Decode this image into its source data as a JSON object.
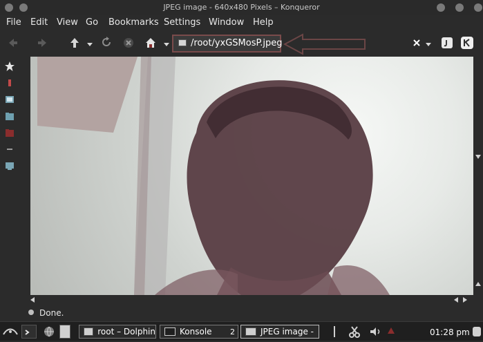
{
  "window": {
    "title": "JPEG image - 640x480 Pixels – Konqueror"
  },
  "menubar": {
    "items": [
      "File",
      "Edit",
      "View",
      "Go",
      "Bookmarks",
      "Settings",
      "Window",
      "Help"
    ]
  },
  "toolbar": {
    "address": "/root/yxGSMosP.jpeg"
  },
  "status": {
    "text": "Done."
  },
  "taskbar": {
    "tasks": [
      {
        "label": "root – Dolphin"
      },
      {
        "label": "Konsole",
        "badge": "2"
      },
      {
        "label": "JPEG image - "
      }
    ],
    "clock": "01:28 pm"
  },
  "colors": {
    "window_bg": "#2b2b2b",
    "address_highlight": "#7a4b4b",
    "annotation_arrow": "#6b4646"
  },
  "icons": {
    "toolbar": [
      "back-arrow-icon",
      "forward-arrow-icon",
      "up-arrow-icon",
      "reload-icon",
      "stop-icon",
      "home-icon",
      "clear-icon",
      "java-icon",
      "konqueror-icon"
    ],
    "sidebar": [
      "star-icon",
      "info-icon",
      "network-icon",
      "folder-icon",
      "home-folder-icon",
      "history-icon",
      "computer-icon"
    ]
  }
}
